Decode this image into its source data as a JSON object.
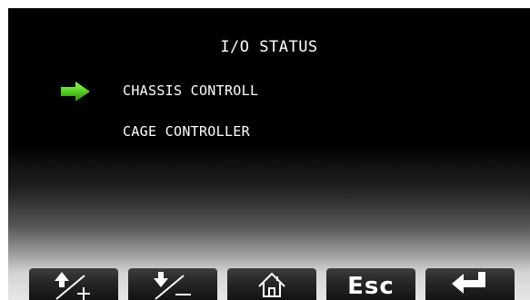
{
  "screen": {
    "title": "I/O STATUS",
    "menu": [
      {
        "label": "CHASSIS CONTROLL",
        "selected": true
      },
      {
        "label": "CAGE CONTROLLER",
        "selected": false
      }
    ],
    "cursor_icon": "green-arrow-right-icon"
  },
  "softkeys": [
    {
      "id": "up",
      "icon": "arrow-up-plus-icon"
    },
    {
      "id": "down",
      "icon": "arrow-down-minus-icon"
    },
    {
      "id": "home",
      "icon": "home-icon"
    },
    {
      "id": "esc",
      "label": "Esc"
    },
    {
      "id": "enter",
      "icon": "enter-return-icon"
    }
  ],
  "colors": {
    "background": "#000000",
    "text": "#ffffff",
    "cursor": "#5fd02a",
    "softkey": "#262626"
  }
}
